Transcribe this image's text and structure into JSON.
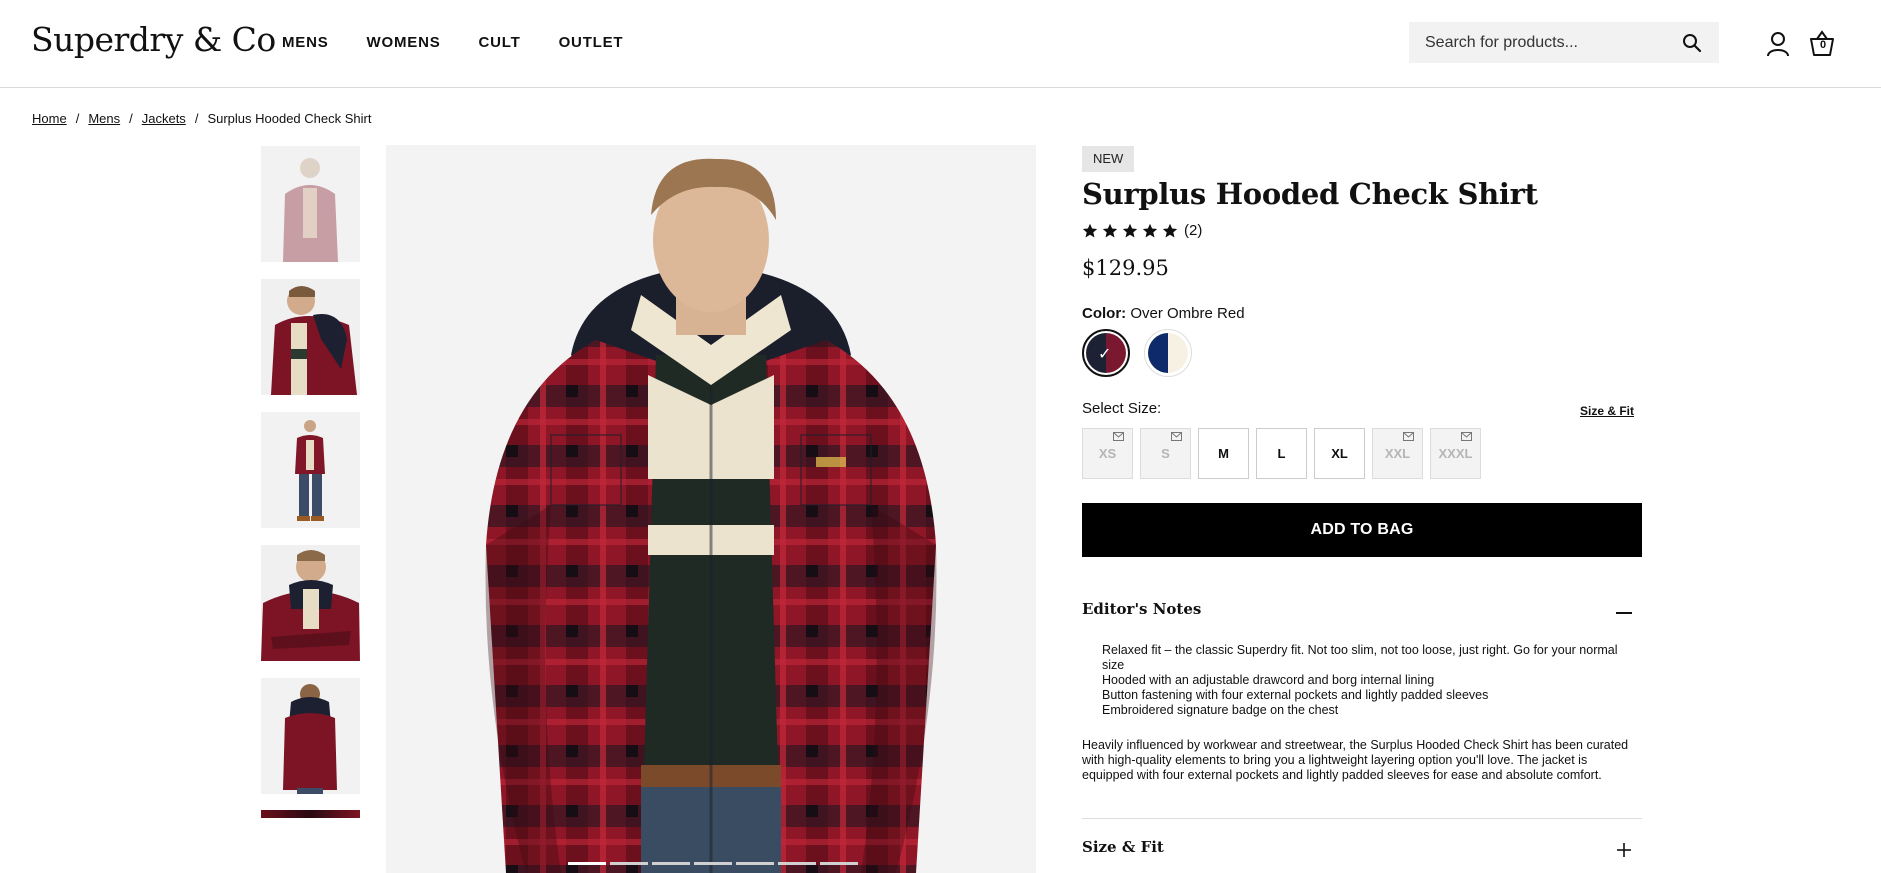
{
  "header": {
    "logo": "Superdry & Co",
    "nav": [
      "MENS",
      "WOMENS",
      "CULT",
      "OUTLET"
    ],
    "search_placeholder": "Search for products...",
    "basket_count": "0",
    "icons": [
      "search-icon",
      "account-icon",
      "basket-icon"
    ]
  },
  "breadcrumb": {
    "items": [
      "Home",
      "Mens",
      "Jackets"
    ],
    "current": "Surplus Hooded Check Shirt",
    "separator": "/"
  },
  "gallery": {
    "thumbnail_count": 5,
    "active_slide": 1,
    "slide_count": 7
  },
  "product": {
    "badge": "NEW",
    "title": "Surplus Hooded Check Shirt",
    "rating": 5,
    "review_count": "(2)",
    "price": "$129.95",
    "color_label": "Color:",
    "color_value": "Over Ombre Red",
    "swatches": [
      {
        "name": "Over Ombre Red",
        "selected": true,
        "colors": [
          "#1c2233",
          "#7a1830"
        ]
      },
      {
        "name": "Navy / Cream",
        "selected": false,
        "colors": [
          "#0e2a6b",
          "#f6f1e3"
        ]
      }
    ],
    "size_label": "Select Size:",
    "size_fit_link": "Size & Fit",
    "sizes": [
      {
        "label": "XS",
        "available": false
      },
      {
        "label": "S",
        "available": false
      },
      {
        "label": "M",
        "available": true
      },
      {
        "label": "L",
        "available": true
      },
      {
        "label": "XL",
        "available": true
      },
      {
        "label": "XXL",
        "available": false
      },
      {
        "label": "XXXL",
        "available": false
      }
    ],
    "add_to_bag": "ADD TO BAG",
    "editors_notes_title": "Editor's Notes",
    "bullets": [
      "Relaxed fit – the classic Superdry fit. Not too slim, not too loose, just right. Go for your normal size",
      "Hooded with an adjustable drawcord and borg internal lining",
      "Button fastening with four external pockets and lightly padded sleeves",
      "Embroidered signature badge on the chest"
    ],
    "description": "Heavily influenced by workwear and streetwear, the Surplus Hooded Check Shirt has been curated with high-quality elements to bring you a lightweight layering option you'll love. The jacket is equipped with four external pockets and lightly padded sleeves for ease and absolute comfort.",
    "size_fit_section": "Size & Fit"
  },
  "colors": {
    "primary": "#000000",
    "oos_background": "#f3f3f3",
    "badge_background": "#e6e6e6"
  }
}
